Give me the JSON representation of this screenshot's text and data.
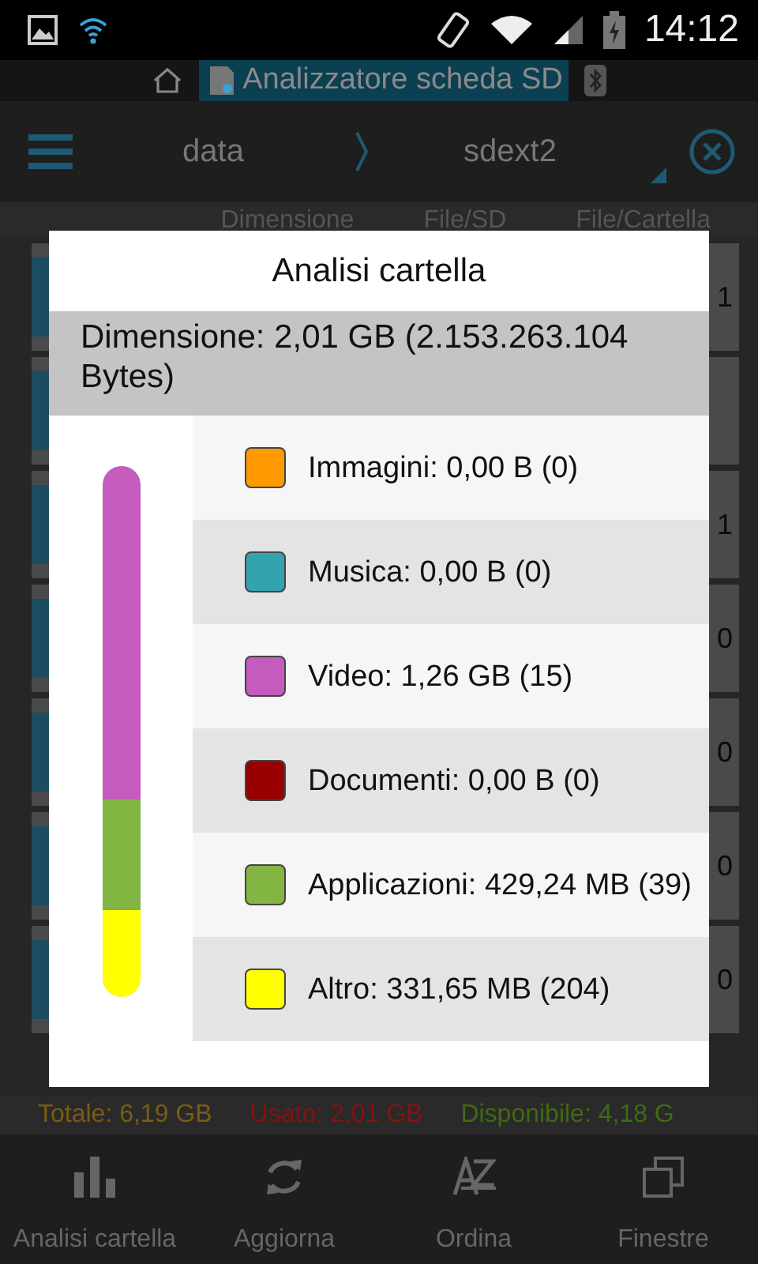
{
  "status_bar": {
    "time": "14:12"
  },
  "title_bar": {
    "title": "Analizzatore scheda SD"
  },
  "toolbar": {
    "path": [
      {
        "label": "data"
      },
      {
        "label": "sdext2"
      }
    ]
  },
  "columns": [
    "Dimensione",
    "File/SD",
    "File/Cartella"
  ],
  "rows": [
    {
      "count": "1"
    },
    {},
    {
      "count": "1"
    },
    {
      "count": "0"
    },
    {
      "count": "0"
    },
    {
      "count": "0"
    },
    {
      "count": "0"
    }
  ],
  "dialog": {
    "title": "Analisi cartella",
    "size": "Dimensione: 2,01 GB (2.153.263.104 Bytes)",
    "categories": [
      {
        "label": "Immagini: 0,00 B (0)",
        "color": "#ff9900"
      },
      {
        "label": "Musica: 0,00 B (0)",
        "color": "#33a3ad"
      },
      {
        "label": "Video: 1,26 GB (15)",
        "color": "#c45bbd",
        "level": 0.627
      },
      {
        "label": "Documenti: 0,00 B (0)",
        "color": "#990000"
      },
      {
        "label": "Applicazioni: 429,24 MB (39)",
        "color": "#82b541",
        "level": 0.208
      },
      {
        "label": "Altro: 331,65 MB (204)",
        "color": "#ffff00",
        "level": 0.165
      }
    ]
  },
  "summary": [
    {
      "kind": "total",
      "text": "Totale: 6,19 GB"
    },
    {
      "kind": "used",
      "text": "Usato: 2,01 GB"
    },
    {
      "kind": "free",
      "text": "Disponibile: 4,18 G"
    }
  ],
  "bottom_nav": [
    {
      "kind": "chart",
      "label": "Analisi cartella"
    },
    {
      "kind": "refresh",
      "label": "Aggiorna"
    },
    {
      "kind": "sort",
      "label": "Ordina"
    },
    {
      "kind": "windows",
      "label": "Finestre"
    }
  ]
}
